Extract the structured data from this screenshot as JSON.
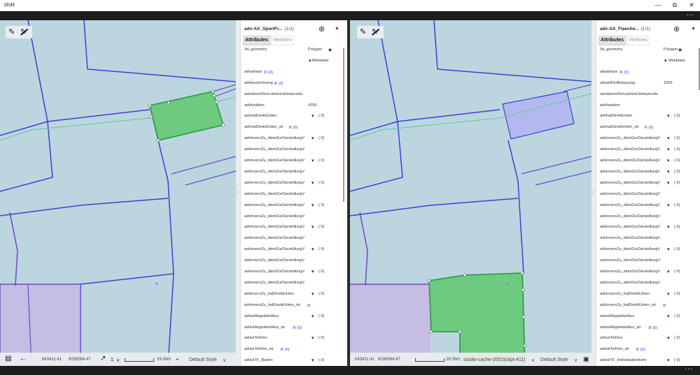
{
  "window": {
    "title": "1Edit",
    "minimize": "—",
    "restore": "⧉",
    "close": "✕"
  },
  "appbar": {
    "more": "..."
  },
  "left": {
    "map": {
      "coords_x": "643411.41",
      "coords_y": "6036564.47",
      "scale_prefix": "1:",
      "scale_distance": "29.56m",
      "style": "Default Style"
    },
    "panel": {
      "title": "adv:AX_SportFr...",
      "count": "(1/1)",
      "tabs": [
        "Attributes",
        "Vertices"
      ],
      "rows": [
        {
          "label": "3d_geometry",
          "value": "Polygon",
          "star": true
        },
        {
          "label": "",
          "value": "Metadata",
          "chevron": true
        },
        {
          "label": "advanlass",
          "list": true,
          "count": "(0)"
        },
        {
          "label": "advbezeichnung",
          "list": true,
          "count": "(0)"
        },
        {
          "label": "advdatumDerLetztenUeberpruefu"
        },
        {
          "label": "advfunktion",
          "value": "4200"
        },
        {
          "label": "advhatDirektUnten",
          "chevron": true,
          "count": "( 0)"
        },
        {
          "label": "advhatDirektUnten_str",
          "list": true,
          "count": "(0)"
        },
        {
          "label": "advinversZu_dientZurDarstellungV",
          "chevron": true,
          "count": "( 0)"
        },
        {
          "label": "advinversZu_dientZurDarstellungV"
        },
        {
          "label": "advinversZu_dientZurDarstellungV",
          "chevron": true,
          "count": "( 0)"
        },
        {
          "label": "advinversZu_dientZurDarstellungV"
        },
        {
          "label": "advinversZu_dientZurDarstellungV",
          "chevron": true,
          "count": "( 0)"
        },
        {
          "label": "advinversZu_dientZurDarstellungV"
        },
        {
          "label": "advinversZu_dientZurDarstellungV",
          "chevron": true,
          "count": "( 0)"
        },
        {
          "label": "advinversZu_dientZurDarstellungV"
        },
        {
          "label": "advinversZu_dientZurDarstellungV",
          "chevron": true,
          "count": "( 0)"
        },
        {
          "label": "advinversZu_dientZurDarstellungV"
        },
        {
          "label": "advinversZu_dientZurDarstellungV",
          "chevron": true,
          "count": "( 0)"
        },
        {
          "label": "advinversZu_dientZurDarstellungV"
        },
        {
          "label": "advinversZu_dientZurDarstellungV",
          "chevron": true,
          "count": "( 0)"
        },
        {
          "label": "advinversZu_dientZurDarstellungV"
        },
        {
          "label": "advinversZu_hatDirektUnten",
          "chevron": true,
          "count": "( 0)"
        },
        {
          "label": "advinversZu_hatDirektUnten_str",
          "list": true,
          "count": ""
        },
        {
          "label": "advistAbgeleitetAus",
          "chevron": true,
          "count": "( 0)"
        },
        {
          "label": "advistAbgeleitetAus_str",
          "list": true,
          "count": "(0)"
        },
        {
          "label": "advistTeilVon",
          "chevron": true,
          "count": "( 0)"
        },
        {
          "label": "advistTeilVon_str",
          "list": true,
          "count": "(0)"
        },
        {
          "label": "advistTF_Baden",
          "chevron": true,
          "count": "( 0)"
        },
        {
          "label": "advistTF_Baden_str",
          "list": true,
          "count": "(0)"
        }
      ]
    }
  },
  "right": {
    "map": {
      "coords_x": "643411.41",
      "coords_y": "6036564.47",
      "scale_distance": "29.56m",
      "cache_label": "studio-cache-2002(ckpt-411)",
      "style": "Default Style"
    },
    "panel": {
      "title": "adv:AX_Flaeche...",
      "count": "(1/1)",
      "tabs": [
        "Attributes",
        "Vertices"
      ],
      "rows": [
        {
          "label": "3d_geometry",
          "value": "Polygon",
          "star": true
        },
        {
          "label": "",
          "value": "Metadata",
          "chevron": true
        },
        {
          "label": "advanlass",
          "list": true,
          "count": "(0)"
        },
        {
          "label": "advartDerBebauung",
          "value": "1000"
        },
        {
          "label": "advdatumDerLetztenUeberpruefu"
        },
        {
          "label": "advfunktion"
        },
        {
          "label": "advhatDirektUnten",
          "chevron": true,
          "count": "( 0)"
        },
        {
          "label": "advhatDirektUnten_str",
          "list": true,
          "count": "(0)"
        },
        {
          "label": "advinversZu_dientZurDarstellungV",
          "chevron": true,
          "count": "( 0)"
        },
        {
          "label": "advinversZu_dientZurDarstellungV",
          "chevron": true,
          "count": "( 0)"
        },
        {
          "label": "advinversZu_dientZurDarstellungV",
          "chevron": true,
          "count": "( 0)"
        },
        {
          "label": "advinversZu_dientZurDarstellungV",
          "chevron": true,
          "count": "( 0)"
        },
        {
          "label": "advinversZu_dientZurDarstellungV",
          "chevron": true,
          "count": "( 0)"
        },
        {
          "label": "advinversZu_dientZurDarstellungV"
        },
        {
          "label": "advinversZu_dientZurDarstellungV",
          "chevron": true,
          "count": "( 0)"
        },
        {
          "label": "advinversZu_dientZurDarstellungV"
        },
        {
          "label": "advinversZu_dientZurDarstellungV",
          "chevron": true,
          "count": "( 0)"
        },
        {
          "label": "advinversZu_dientZurDarstellungV"
        },
        {
          "label": "advinversZu_dientZurDarstellungV",
          "chevron": true,
          "count": "( 0)"
        },
        {
          "label": "advinversZu_dientZurDarstellungV"
        },
        {
          "label": "advinversZu_dientZurDarstellungV",
          "chevron": true,
          "count": "( 0)"
        },
        {
          "label": "advinversZu_dientZurDarstellungV"
        },
        {
          "label": "advinversZu_hatDirektUnten",
          "chevron": true,
          "count": "( 0)"
        },
        {
          "label": "advinversZu_hatDirektUnten_str",
          "list": true,
          "count": ""
        },
        {
          "label": "advistAbgeleitetAus",
          "chevron": true,
          "count": "( 0)"
        },
        {
          "label": "advistAbgeleitetAus_str",
          "list": true,
          "count": "(0)"
        },
        {
          "label": "advistTeilVon",
          "chevron": true,
          "count": "( 0)"
        },
        {
          "label": "advistTeilVon_str",
          "list": true,
          "count": "(0)"
        },
        {
          "label": "advistTF_Individualverkehr",
          "chevron": true,
          "count": "( 0)"
        },
        {
          "label": "advistTF_Individualverkehr_str",
          "list": true,
          "count": "(0)"
        }
      ]
    }
  },
  "icons": {
    "pencil": "✎",
    "star": "★",
    "chevron": "▾",
    "list": "≣",
    "zoom": "⊕",
    "caret_up": "▲",
    "arrow_left": "←",
    "arrow_diag": "↗",
    "layers": "▤",
    "pin": "⌖",
    "style_chevron": "∨",
    "bookmark": "▣"
  },
  "colors": {
    "map_bg": "#bcd6e0",
    "highlight_fill": "#6ccb7e",
    "highlight_stroke": "#2f9e48",
    "boundary": "#3b3fd4",
    "link_text": "#3a36c9"
  }
}
